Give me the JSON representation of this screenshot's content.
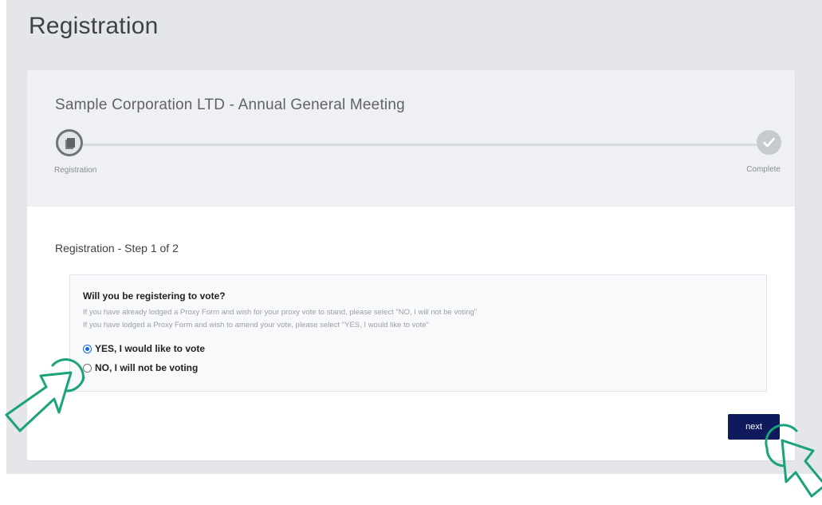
{
  "page": {
    "title": "Registration"
  },
  "card": {
    "meeting_title": "Sample Corporation LTD - Annual General Meeting",
    "steps": [
      {
        "label": "Registration",
        "state": "active",
        "icon": "document-icon"
      },
      {
        "label": "Complete",
        "state": "done",
        "icon": "check-icon"
      }
    ],
    "step_heading": "Registration - Step 1 of 2"
  },
  "question": {
    "title": "Will you be registering to vote?",
    "help_lines": [
      "If you have already lodged a Proxy Form and wish for your proxy vote to stand, please select \"NO, I will not be voting\"",
      "If you have lodged a Proxy Form and wish to amend your vote, please select \"YES, I would like to vote\""
    ],
    "options": [
      {
        "label": "YES, I would like to vote",
        "selected": true
      },
      {
        "label": "NO, I will not be voting",
        "selected": false
      }
    ]
  },
  "actions": {
    "next_label": "next"
  },
  "colors": {
    "accent": "#0e1a5c",
    "radio_selected": "#1565d8",
    "cursor_annotation": "#1aa37a"
  },
  "annotations": {
    "cursor_icons": [
      "pointer-cursor-icon",
      "pointer-cursor-icon"
    ]
  }
}
